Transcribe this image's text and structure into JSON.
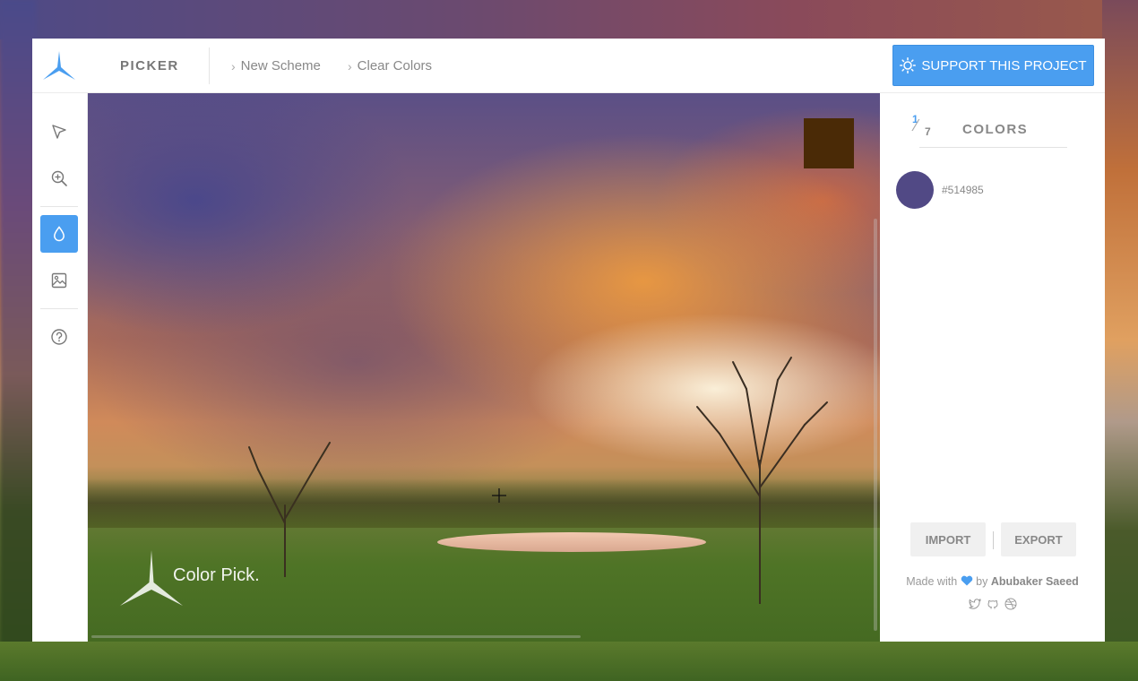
{
  "app": {
    "title": "PICKER",
    "breadcrumbs": [
      {
        "label": "New Scheme"
      },
      {
        "label": "Clear Colors"
      }
    ],
    "support_label": "SUPPORT THIS PROJECT"
  },
  "toolbar": {
    "tools": [
      {
        "icon": "cursor-icon",
        "active": false
      },
      {
        "icon": "zoom-in-icon",
        "active": false
      },
      {
        "icon": "eyedropper-drop-icon",
        "active": true
      },
      {
        "icon": "image-icon",
        "active": false
      },
      {
        "icon": "help-icon",
        "active": false
      }
    ]
  },
  "canvas": {
    "preview_color": "#4a2a06",
    "watermark_text": "Color Pick."
  },
  "panel": {
    "counter_current": "1",
    "counter_total": "7",
    "title": "COLORS",
    "colors": [
      {
        "hex": "#514985"
      }
    ],
    "import_label": "IMPORT",
    "export_label": "EXPORT",
    "credit_prefix": "Made with",
    "credit_by": "by",
    "credit_author": "Abubaker Saeed",
    "social_icons": [
      "twitter-icon",
      "github-icon",
      "dribbble-icon"
    ]
  },
  "colors": {
    "accent": "#4a9ef0",
    "heart": "#4a9ef0"
  }
}
